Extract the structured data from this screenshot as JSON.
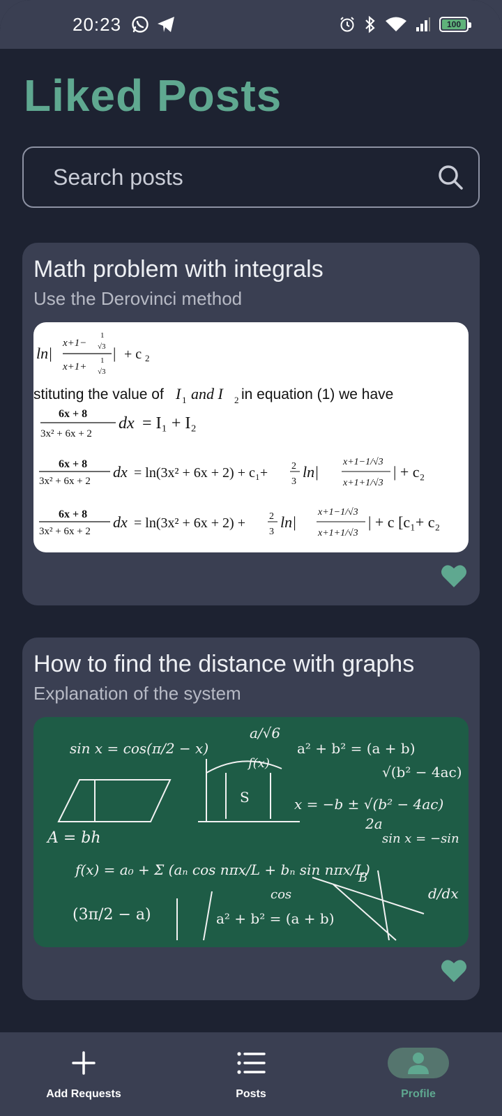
{
  "status_bar": {
    "time": "20:23",
    "battery_level": "100",
    "icons_left": [
      "whatsapp-icon",
      "telegram-icon"
    ],
    "icons_right": [
      "alarm-icon",
      "bluetooth-icon",
      "wifi-icon",
      "signal-icon",
      "battery-icon"
    ]
  },
  "page": {
    "title": "Liked Posts"
  },
  "search": {
    "placeholder": "Search posts"
  },
  "posts": [
    {
      "title": "Math problem with integrals",
      "subtitle": "Use the Derovinci method",
      "image": {
        "lines": [
          "ln| x+1−1/√3 / x+1+1/√3 | + c₂",
          "stituting the value of I₁ and I₂ in equation (1) we have",
          "6x + 8 / 3x² + 6x + 2 dx = I₁ + I₂",
          "6x + 8 / 3x² + 6x + 2 dx = ln(3x² + 6x + 2) + c₁+ 2/3 ln| x+1−1/√3 / x+1+1/√3 | + c₂",
          "6x + 8 / 3x² + 6x + 2 dx = ln(3x² + 6x + 2) + 2/3 ln| x+1−1/√3 / x+1+1/√3 | + c [c₁+ c₂"
        ]
      },
      "liked": true
    },
    {
      "title": "How to find the distance with graphs",
      "subtitle": "Explanation of the system",
      "image": {
        "formulas": [
          "sin x = cos(π/2 − x)",
          "a/√6",
          "a² + b² = (a + b)",
          "√(b² − 4ac)",
          "x = −b ± √(b² − 4ac) / 2a",
          "A = bh",
          "f(x) = a₀ + Σ (aₙ cos nπx/L + bₙ sin nπx/L)",
          "(3π/2 − a)",
          "a² + b² = (a + b)",
          "d/dx",
          "f(x)",
          "S",
          "cos",
          "sin x = −sin",
          "B"
        ]
      },
      "liked": true
    }
  ],
  "bottom_nav": {
    "items": [
      {
        "label": "Add Requests",
        "icon": "plus-icon",
        "active": false
      },
      {
        "label": "Posts",
        "icon": "list-icon",
        "active": false
      },
      {
        "label": "Profile",
        "icon": "person-icon",
        "active": true
      }
    ]
  },
  "colors": {
    "accent": "#5fa890",
    "background": "#1d2231",
    "card": "#3a3f52"
  }
}
